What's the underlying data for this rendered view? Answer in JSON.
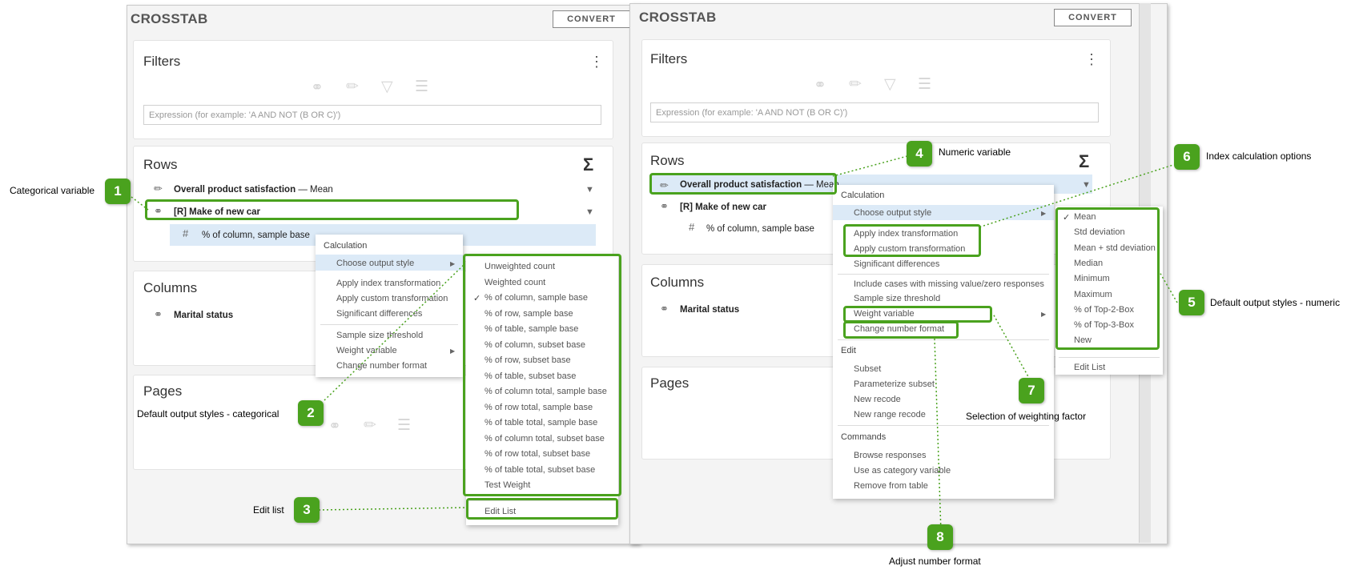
{
  "left": {
    "title": "CROSSTAB",
    "convert": "CONVERT",
    "filters_title": "Filters",
    "expr_placeholder": "Expression (for example: 'A AND NOT (B OR C)')",
    "rows_title": "Rows",
    "row1_name": "Overall product satisfaction",
    "row1_stat": "— Mean",
    "row2_name": "[R] Make of new car",
    "row2_sub": "% of column, sample base",
    "columns_title": "Columns",
    "col1": "Marital status",
    "pages_title": "Pages"
  },
  "right": {
    "title": "CROSSTAB",
    "convert": "CONVERT",
    "filters_title": "Filters",
    "expr_placeholder": "Expression (for example: 'A AND NOT (B OR C)')",
    "rows_title": "Rows",
    "row1_name": "Overall product satisfaction",
    "row1_stat": "— Mean",
    "row2_name": "[R] Make of new car",
    "row2_sub": "% of column, sample base",
    "columns_title": "Columns",
    "col1": "Marital status",
    "pages_title": "Pages"
  },
  "menu_left": {
    "calc": "Calculation",
    "choose": "Choose output style",
    "index": "Apply index transformation",
    "custom": "Apply custom transformation",
    "signif": "Significant differences",
    "sample": "Sample size threshold",
    "weight": "Weight variable",
    "number": "Change number format"
  },
  "styles_categorical": [
    "Unweighted count",
    "Weighted count",
    "% of column, sample base",
    "% of row, sample base",
    "% of table, sample base",
    "% of column, subset base",
    "% of row, subset base",
    "% of table, subset base",
    "% of column total, sample base",
    "% of row total, sample base",
    "% of table total, sample base",
    "% of column total, subset base",
    "% of row total, subset base",
    "% of table total, subset base",
    "Test Weight"
  ],
  "styles_categorical_checked": "% of column, sample base",
  "edit_list": "Edit List",
  "menu_right": {
    "calc": "Calculation",
    "choose": "Choose output style",
    "index": "Apply index transformation",
    "custom": "Apply custom transformation",
    "signif": "Significant differences",
    "missing": "Include cases with missing value/zero responses",
    "sample": "Sample size threshold",
    "weight": "Weight variable",
    "number": "Change number format",
    "edit": "Edit",
    "subset": "Subset",
    "param": "Parameterize subset",
    "recode": "New recode",
    "range": "New range recode",
    "commands": "Commands",
    "browse": "Browse responses",
    "usecat": "Use as category variable",
    "remove": "Remove from table"
  },
  "styles_numeric": [
    "Mean",
    "Std deviation",
    "Mean + std deviation",
    "Median",
    "Minimum",
    "Maximum",
    "% of Top-2-Box",
    "% of Top-3-Box",
    "New"
  ],
  "styles_numeric_checked": "Mean",
  "annotations": {
    "n1": "1",
    "t1": "Categorical variable",
    "n2": "2",
    "t2": "Default output styles - categorical",
    "n3": "3",
    "t3": "Edit list",
    "n4": "4",
    "t4": "Numeric variable",
    "n5": "5",
    "t5": "Default output styles - numeric",
    "n6": "6",
    "t6": "Index calculation options",
    "n7": "7",
    "t7": "Selection of weighting factor",
    "n8": "8",
    "t8": "Adjust number format"
  },
  "icons": [
    "kebab-icon",
    "sigma-icon",
    "ruler-icon",
    "category-icon",
    "hash-icon",
    "funnel-icon",
    "list-icon",
    "checkmark-icon",
    "submenu-arrow-icon"
  ],
  "colors": {
    "annotation_green": "#4aa21e",
    "selection_blue": "#dceaf7",
    "panel_bg": "#f4f4f4"
  }
}
